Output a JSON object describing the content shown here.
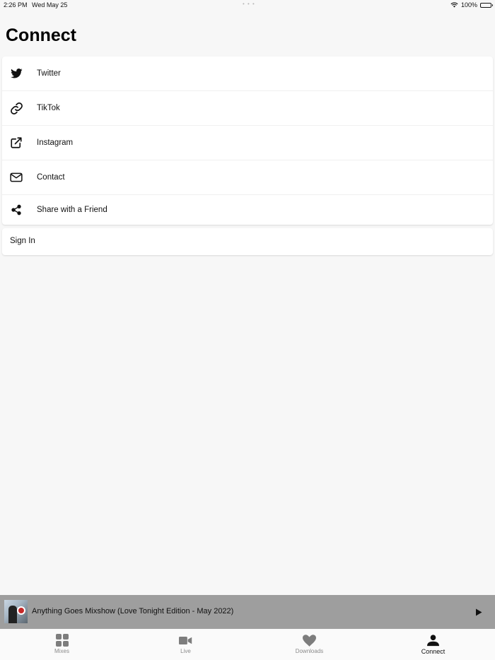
{
  "status_bar": {
    "time": "2:26 PM",
    "date": "Wed May 25",
    "battery": "100%",
    "multitask_dots": "• • •"
  },
  "page_title": "Connect",
  "links": [
    {
      "label": "Twitter",
      "icon": "twitter-icon"
    },
    {
      "label": "TikTok",
      "icon": "link-icon"
    },
    {
      "label": "Instagram",
      "icon": "external-link-icon"
    },
    {
      "label": "Contact",
      "icon": "envelope-icon"
    },
    {
      "label": "Share with a Friend",
      "icon": "share-icon"
    }
  ],
  "sign_in": {
    "label": "Sign In"
  },
  "player": {
    "track_title": "Anything Goes Mixshow (Love Tonight Edition - May 2022)",
    "state": "paused",
    "bar_color": "#9e9e9e"
  },
  "tabs": [
    {
      "label": "Mixes",
      "icon": "grid-icon",
      "active": false
    },
    {
      "label": "Live",
      "icon": "video-camera-icon",
      "active": false
    },
    {
      "label": "Downloads",
      "icon": "heart-icon",
      "active": false
    },
    {
      "label": "Connect",
      "icon": "person-icon",
      "active": true
    }
  ],
  "colors": {
    "background": "#f7f7f7",
    "inactive_tab": "#8a8a8a",
    "active_tab": "#111111"
  }
}
